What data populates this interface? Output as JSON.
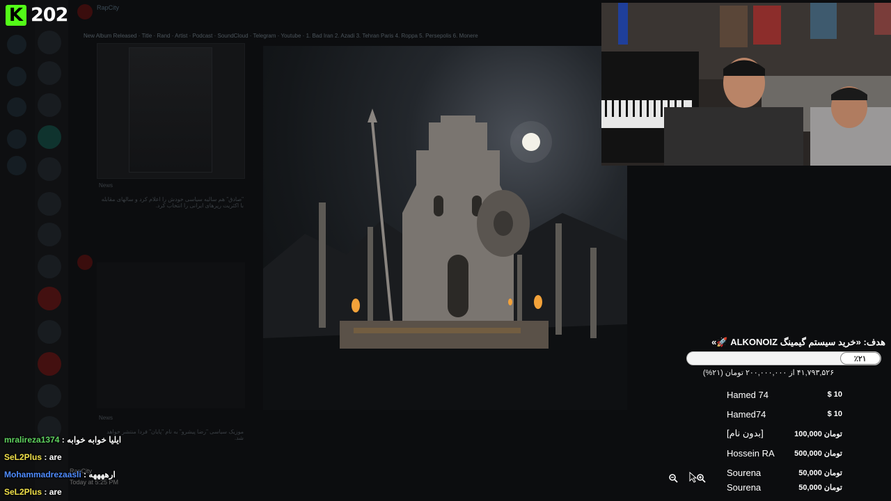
{
  "stream": {
    "viewer_count": "202",
    "brand_color": "#53fc18"
  },
  "background_app": {
    "channel_name": "RapCity",
    "ticker_text": "New Album Released · Title · Rand · Artist · Podcast · SoundCloud · Telegram · Youtube · 1. Bad Iran 2. Azadi 3. Tehran Paris 4. Roppa 5. Persepolis 6. Monere",
    "post_tag": "News",
    "post_excerpt": "\"صادق\" هم سالیه سیاسی خودش را اعلام کرد و سالهای مقابله با اکثریت رپرهای ایرانی را انتخاب کرد.",
    "post2_tag": "News",
    "post2_excerpt": "موزیک سیاسی \"رضا پیشرو\" به نام \"پایان\" فردا منتشر خواهد شد.",
    "bottom_name": "RapCity",
    "bottom_time": "Today at 5:25 PM"
  },
  "goal": {
    "title": "هدف: «خرید سیستم گیمینگ ALKONOIZ 🚀»",
    "percent_label": "٪۲۱",
    "percent": 0.21,
    "amount_text": "۴۱,۷۹۳,۵۲۶ از ۲۰۰,۰۰۰,۰۰۰ تومان (۲۱%)"
  },
  "donations": [
    {
      "name": "Hamed 74",
      "amount": "$ 10",
      "color": "green"
    },
    {
      "name": "Hamed74",
      "amount": "$ 10",
      "color": "green"
    },
    {
      "name": "[بدون نام]",
      "amount": "100,000 تومان",
      "color": "orange"
    },
    {
      "name": "Hossein RA",
      "amount": "500,000 تومان",
      "color": "orange"
    },
    {
      "name": "Sourena",
      "amount": "50,000 تومان",
      "color": "pink"
    },
    {
      "name": "Sourena",
      "amount": "50,000 تومان",
      "color": "pink"
    }
  ],
  "chat": [
    {
      "user": "mralireza1374",
      "msg": "ایلیا خوابه خوابه",
      "color": "green"
    },
    {
      "user": "SeL2Plus",
      "msg": "are",
      "color": "yellow"
    },
    {
      "user": "Mohammadrezaasli",
      "msg": "ارههههه",
      "color": "blue"
    },
    {
      "user": "SeL2Plus",
      "msg": "are",
      "color": "yellow"
    }
  ],
  "icons": {
    "zoom_out": "zoom-out-icon",
    "cursor": "cursor-icon",
    "zoom_in": "zoom-in-icon"
  }
}
